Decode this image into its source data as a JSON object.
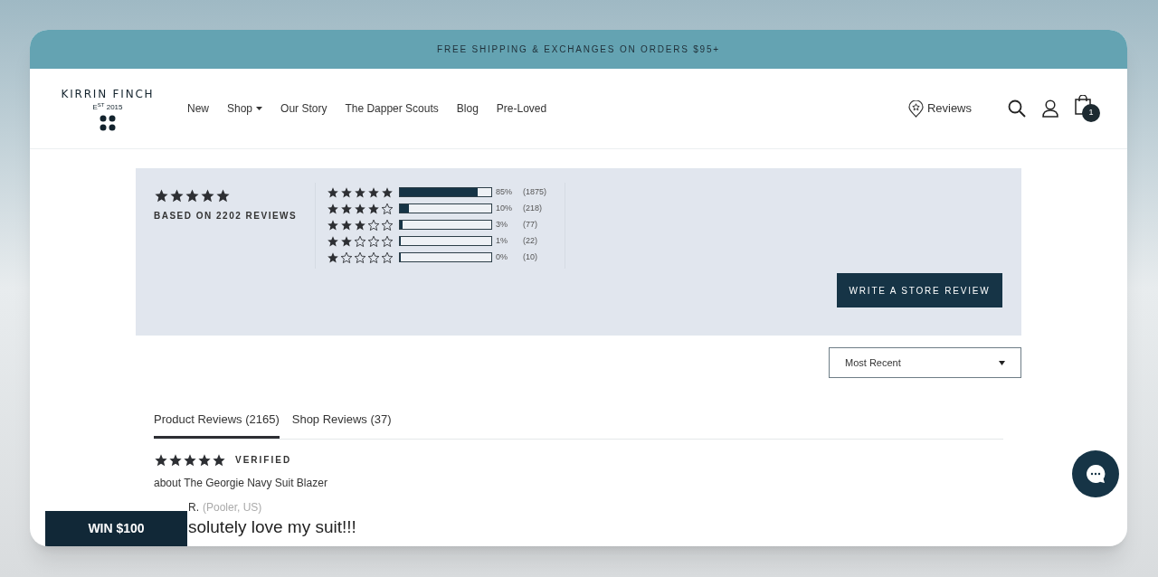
{
  "banner": {
    "text": "FREE SHIPPING & EXCHANGES ON ORDERS $95+"
  },
  "logo": {
    "name": "KIRRIN FINCH",
    "est": "E$^{ST}$ 2015"
  },
  "nav": [
    {
      "label": "New",
      "kind": "link"
    },
    {
      "label": "Shop",
      "kind": "dropdown"
    },
    {
      "label": "Our Story",
      "kind": "link"
    },
    {
      "label": "The Dapper Scouts",
      "kind": "link"
    },
    {
      "label": "Blog",
      "kind": "link"
    },
    {
      "label": "Pre-Loved",
      "kind": "link"
    }
  ],
  "header_actions": {
    "reviews_label": "Reviews",
    "cart_count": "1"
  },
  "summary": {
    "stars": 5,
    "caption": "BASED ON 2202 REVIEWS",
    "write_button": "WRITE A STORE REVIEW",
    "breakdown": [
      {
        "stars": 5,
        "level": 0.85,
        "percent": "85%",
        "count": "(1875)"
      },
      {
        "stars": 4,
        "level": 0.1,
        "percent": "10%",
        "count": "(218)"
      },
      {
        "stars": 3,
        "level": 0.03,
        "percent": "3%",
        "count": "(77)"
      },
      {
        "stars": 2,
        "level": 0.01,
        "percent": "1%",
        "count": "(22)"
      },
      {
        "stars": 1,
        "level": 0,
        "percent": "0%",
        "count": "(10)"
      }
    ]
  },
  "sort": {
    "value": "Most Recent"
  },
  "tabs": [
    {
      "label": "Product Reviews (2165)",
      "selected": true
    },
    {
      "label": "Shop Reviews (37)",
      "selected": false
    }
  ],
  "review": {
    "stars": 5,
    "badge": "VERIFIED",
    "product": "about The Georgie Navy Suit Blazer",
    "author": "R.",
    "location": "(Pooler, US)",
    "title": "solutely love my suit!!!"
  },
  "promo": {
    "label": "WIN $100"
  }
}
